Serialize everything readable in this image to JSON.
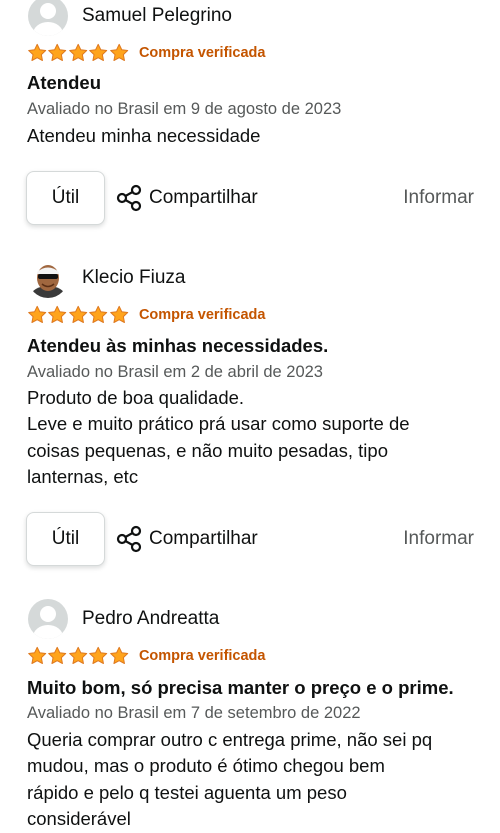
{
  "reviews": [
    {
      "reviewer_name": "Samuel Pelegrino",
      "avatar": "default-profile-icon",
      "rating": 5,
      "verified_label": "Compra verificada",
      "title": "Atendeu",
      "date": "Avaliado no Brasil em 9 de agosto de 2023",
      "body_lines": [
        "Atendeu minha necessidade"
      ],
      "helpful_label": "Útil",
      "share_label": "Compartilhar",
      "report_label": "Informar"
    },
    {
      "reviewer_name": "Klecio Fiuza",
      "avatar": "profile-photo",
      "rating": 5,
      "verified_label": "Compra verificada",
      "title": "Atendeu às minhas necessidades.",
      "date": "Avaliado no Brasil em 2 de abril de 2023",
      "body_lines": [
        "Produto de boa qualidade.",
        "Leve e muito prático prá usar como suporte de",
        "coisas pequenas, e não muito pesadas, tipo",
        "lanternas, etc"
      ],
      "helpful_label": "Útil",
      "share_label": "Compartilhar",
      "report_label": "Informar"
    },
    {
      "reviewer_name": "Pedro Andreatta",
      "avatar": "default-profile-icon",
      "rating": 5,
      "verified_label": "Compra verificada",
      "title": "Muito bom, só precisa manter o preço e o prime.",
      "date": "Avaliado no Brasil em 7 de setembro de 2022",
      "body_lines": [
        "Queria comprar outro c entrega prime, não sei pq",
        "mudou, mas o produto é ótimo chegou bem",
        "rápido e pelo q testei aguenta um peso",
        "considerável"
      ]
    }
  ],
  "colors": {
    "star": "#ffa41c",
    "star_outline": "#de7921",
    "verified": "#c45500",
    "secondary_text": "#565959",
    "primary_text": "#0f1111",
    "border": "#d5d9d9"
  }
}
